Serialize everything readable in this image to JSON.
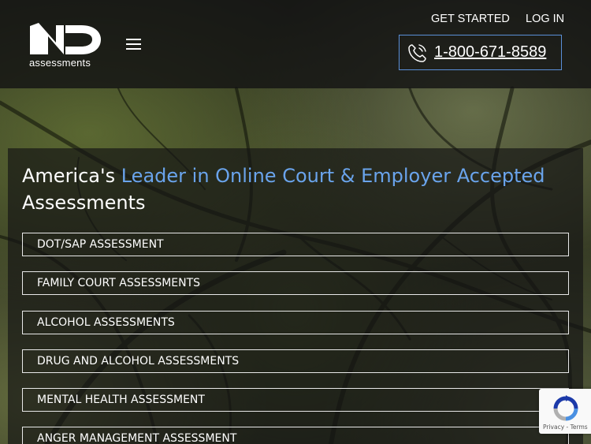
{
  "header": {
    "logo_text": "assessments",
    "nav": {
      "get_started": "GET STARTED",
      "log_in": "LOG IN"
    },
    "phone": "1-800-671-8589"
  },
  "hero": {
    "headline_prefix": "America's ",
    "headline_accent": "Leader in Online Court & Employer Accepted",
    "headline_suffix": "Assessments"
  },
  "services": [
    "DOT/SAP ASSESSMENT",
    "FAMILY COURT ASSESSMENTS",
    "ALCOHOL ASSESSMENTS",
    "DRUG AND ALCOHOL ASSESSMENTS",
    "MENTAL HEALTH ASSESSMENT",
    "ANGER MANAGEMENT ASSESSMENT"
  ],
  "recaptcha": {
    "terms": "Privacy - Terms"
  },
  "colors": {
    "accent": "#6aa4ec",
    "phone_border": "#5a8fd8",
    "header_bg": "#141414"
  },
  "icons": [
    "menu-icon",
    "phone-icon",
    "recaptcha-icon"
  ]
}
